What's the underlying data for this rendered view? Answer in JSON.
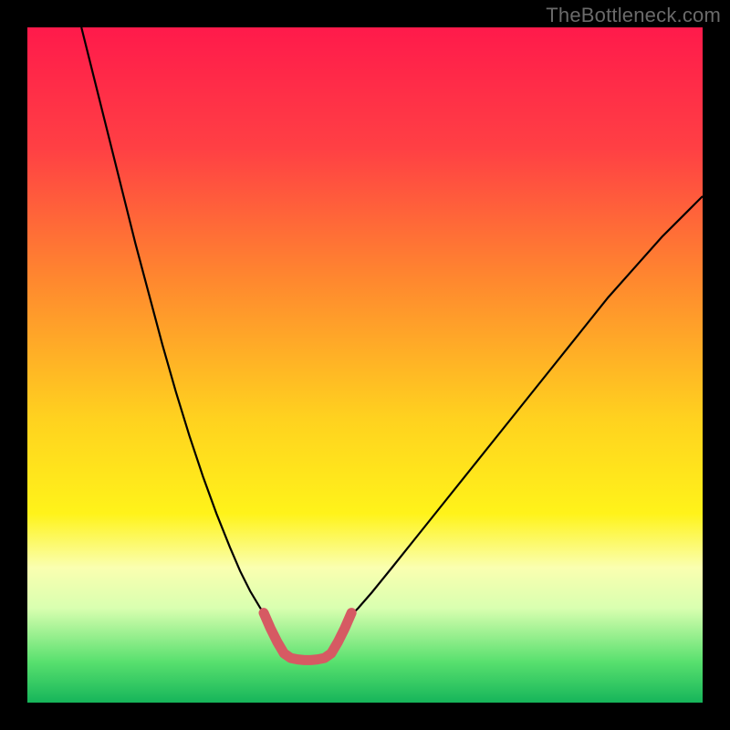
{
  "watermark": "TheBottleneck.com",
  "chart_data": {
    "type": "line",
    "title": "",
    "xlabel": "",
    "ylabel": "",
    "xlim": [
      0,
      100
    ],
    "ylim": [
      0,
      100
    ],
    "gradient_stops": [
      {
        "offset": 0,
        "color": "#ff1a4b"
      },
      {
        "offset": 18,
        "color": "#ff4044"
      },
      {
        "offset": 38,
        "color": "#ff8a2e"
      },
      {
        "offset": 58,
        "color": "#ffd21f"
      },
      {
        "offset": 72,
        "color": "#fff31a"
      },
      {
        "offset": 80,
        "color": "#faffb0"
      },
      {
        "offset": 86,
        "color": "#d9ffb0"
      },
      {
        "offset": 94,
        "color": "#58e06e"
      },
      {
        "offset": 100,
        "color": "#16b55a"
      }
    ],
    "series": [
      {
        "name": "left-curve",
        "stroke": "#000000",
        "width": 2.2,
        "points": [
          {
            "x": 8.0,
            "y": 100.0
          },
          {
            "x": 10.0,
            "y": 92.0
          },
          {
            "x": 12.0,
            "y": 84.0
          },
          {
            "x": 14.0,
            "y": 76.0
          },
          {
            "x": 16.0,
            "y": 68.0
          },
          {
            "x": 18.0,
            "y": 60.5
          },
          {
            "x": 20.0,
            "y": 53.0
          },
          {
            "x": 22.0,
            "y": 46.0
          },
          {
            "x": 24.0,
            "y": 39.5
          },
          {
            "x": 26.0,
            "y": 33.5
          },
          {
            "x": 28.0,
            "y": 28.0
          },
          {
            "x": 30.0,
            "y": 23.0
          },
          {
            "x": 31.5,
            "y": 19.5
          },
          {
            "x": 33.0,
            "y": 16.5
          },
          {
            "x": 34.5,
            "y": 14.0
          },
          {
            "x": 36.0,
            "y": 12.0
          }
        ]
      },
      {
        "name": "right-curve",
        "stroke": "#000000",
        "width": 2.2,
        "points": [
          {
            "x": 47.0,
            "y": 12.0
          },
          {
            "x": 49.0,
            "y": 14.0
          },
          {
            "x": 51.0,
            "y": 16.3
          },
          {
            "x": 54.0,
            "y": 20.0
          },
          {
            "x": 58.0,
            "y": 25.0
          },
          {
            "x": 62.0,
            "y": 30.0
          },
          {
            "x": 66.0,
            "y": 35.0
          },
          {
            "x": 70.0,
            "y": 40.0
          },
          {
            "x": 74.0,
            "y": 45.0
          },
          {
            "x": 78.0,
            "y": 50.0
          },
          {
            "x": 82.0,
            "y": 55.0
          },
          {
            "x": 86.0,
            "y": 60.0
          },
          {
            "x": 90.0,
            "y": 64.5
          },
          {
            "x": 94.0,
            "y": 69.0
          },
          {
            "x": 98.0,
            "y": 73.0
          },
          {
            "x": 100.0,
            "y": 75.0
          }
        ]
      },
      {
        "name": "highlight-segment",
        "stroke": "#d65a63",
        "width": 11,
        "linecap": "round",
        "points": [
          {
            "x": 35.0,
            "y": 13.3
          },
          {
            "x": 36.0,
            "y": 11.0
          },
          {
            "x": 37.0,
            "y": 9.0
          },
          {
            "x": 38.0,
            "y": 7.3
          },
          {
            "x": 39.0,
            "y": 6.6
          },
          {
            "x": 40.0,
            "y": 6.4
          },
          {
            "x": 41.0,
            "y": 6.3
          },
          {
            "x": 42.0,
            "y": 6.3
          },
          {
            "x": 43.0,
            "y": 6.4
          },
          {
            "x": 44.0,
            "y": 6.6
          },
          {
            "x": 45.0,
            "y": 7.3
          },
          {
            "x": 46.0,
            "y": 9.0
          },
          {
            "x": 47.0,
            "y": 11.0
          },
          {
            "x": 48.0,
            "y": 13.3
          }
        ]
      }
    ]
  }
}
